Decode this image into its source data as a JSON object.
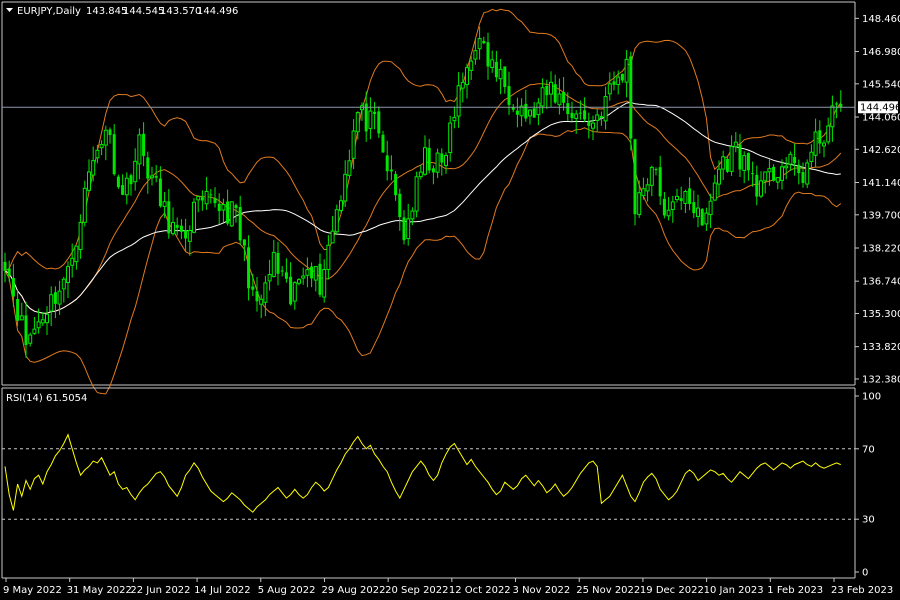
{
  "chart_data": [
    {
      "type": "candlestick",
      "header": {
        "symbol_timeframe": "EURJPY,Daily",
        "open": "143.845",
        "high": "144.545",
        "low": "143.570",
        "close": "144.496"
      },
      "price_axis_ticks": [
        "148.460",
        "146.980",
        "145.540",
        "144.060",
        "142.620",
        "141.140",
        "139.700",
        "138.220",
        "136.740",
        "135.300",
        "133.820",
        "132.380"
      ],
      "last_price_label": "144.496",
      "last_price": 144.496,
      "ylim": [
        132.2,
        149.1
      ],
      "date_ticks": [
        "9 May 2022",
        "31 May 2022",
        "22 Jun 2022",
        "14 Jul 2022",
        "5 Aug 2022",
        "29 Aug 2022",
        "20 Sep 2022",
        "12 Oct 2022",
        "3 Nov 2022",
        "25 Nov 2022",
        "19 Dec 2022",
        "10 Jan 2023",
        "1 Feb 2023",
        "23 Feb 2023"
      ],
      "close_anchors": [
        [
          0,
          137.8
        ],
        [
          5,
          134.0
        ],
        [
          10,
          135.6
        ],
        [
          15,
          137.0
        ],
        [
          20,
          141.5
        ],
        [
          24,
          143.7
        ],
        [
          28,
          140.5
        ],
        [
          32,
          142.8
        ],
        [
          38,
          139.8
        ],
        [
          42,
          138.4
        ],
        [
          45,
          139.9
        ],
        [
          50,
          140.3
        ],
        [
          55,
          139.6
        ],
        [
          60,
          135.3
        ],
        [
          64,
          137.6
        ],
        [
          68,
          135.8
        ],
        [
          72,
          137.8
        ],
        [
          75,
          136.6
        ],
        [
          80,
          140.8
        ],
        [
          84,
          144.2
        ],
        [
          88,
          143.6
        ],
        [
          92,
          141.2
        ],
        [
          95,
          138.8
        ],
        [
          100,
          142.2
        ],
        [
          104,
          141.8
        ],
        [
          108,
          145.0
        ],
        [
          112,
          147.5
        ],
        [
          116,
          146.3
        ],
        [
          120,
          145.2
        ],
        [
          125,
          144.0
        ],
        [
          130,
          145.3
        ],
        [
          135,
          144.3
        ],
        [
          140,
          143.8
        ],
        [
          145,
          145.5
        ],
        [
          148,
          146.3
        ],
        [
          150,
          140.2
        ],
        [
          154,
          141.8
        ],
        [
          158,
          139.5
        ],
        [
          162,
          141.0
        ],
        [
          166,
          139.0
        ],
        [
          170,
          141.8
        ],
        [
          174,
          142.6
        ],
        [
          180,
          140.8
        ],
        [
          185,
          142.0
        ],
        [
          190,
          141.5
        ],
        [
          193,
          142.8
        ],
        [
          197,
          144.0
        ],
        [
          199,
          144.5
        ]
      ],
      "indicators": [
        "Bollinger Bands (20)",
        "Moving Average (50)"
      ]
    },
    {
      "type": "line",
      "label": "RSI(14) 61.5054",
      "ylim": [
        0,
        100
      ],
      "y_ticks": [
        "100",
        "70",
        "30",
        "0"
      ],
      "levels": [
        70,
        30
      ],
      "values": [
        60,
        44,
        35,
        50,
        43,
        52,
        47,
        53,
        55,
        50,
        57,
        61,
        66,
        69,
        73,
        78,
        70,
        62,
        55,
        58,
        60,
        63,
        62,
        65,
        60,
        55,
        57,
        50,
        47,
        48,
        44,
        41,
        45,
        48,
        50,
        53,
        56,
        57,
        54,
        49,
        46,
        43,
        48,
        55,
        58,
        62,
        59,
        54,
        50,
        46,
        44,
        42,
        40,
        42,
        45,
        43,
        41,
        38,
        36,
        34,
        37,
        39,
        41,
        44,
        46,
        48,
        45,
        42,
        44,
        47,
        44,
        42,
        44,
        48,
        51,
        49,
        46,
        48,
        53,
        58,
        62,
        67,
        70,
        74,
        77,
        73,
        70,
        72,
        67,
        64,
        60,
        57,
        51,
        46,
        42,
        47,
        52,
        57,
        60,
        63,
        60,
        55,
        52,
        55,
        62,
        67,
        71,
        73,
        69,
        65,
        61,
        64,
        60,
        57,
        54,
        51,
        47,
        44,
        46,
        51,
        49,
        47,
        49,
        53,
        55,
        52,
        49,
        52,
        49,
        45,
        47,
        50,
        46,
        43,
        45,
        48,
        52,
        56,
        59,
        62,
        63,
        60,
        39,
        41,
        43,
        47,
        51,
        55,
        49,
        43,
        40,
        45,
        51,
        54,
        56,
        53,
        47,
        44,
        41,
        43,
        46,
        51,
        56,
        58,
        56,
        52,
        54,
        56,
        58,
        57,
        55,
        56,
        53,
        51,
        54,
        57,
        55,
        53,
        56,
        59,
        61,
        62,
        60,
        58,
        60,
        62,
        61,
        59,
        61,
        62,
        63,
        61,
        60,
        62,
        60,
        59,
        60,
        61,
        62,
        61
      ]
    }
  ]
}
